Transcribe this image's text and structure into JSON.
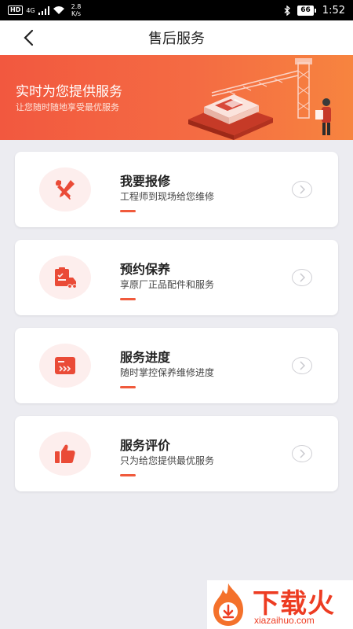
{
  "status_bar": {
    "hd": "HD",
    "signal_type": "4G",
    "speed_value": "2.8",
    "speed_unit": "K/s",
    "battery": "66",
    "time": "1:52"
  },
  "nav": {
    "title": "售后服务",
    "back_icon": "chevron-left-icon"
  },
  "banner": {
    "title": "实时为您提供服务",
    "subtitle": "让您随时随地享受最优服务"
  },
  "services": [
    {
      "title": "我要报修",
      "desc": "工程师到现场给您维修",
      "icon": "repair-tools-icon"
    },
    {
      "title": "预约保养",
      "desc": "享原厂正品配件和服务",
      "icon": "truck-checklist-icon"
    },
    {
      "title": "服务进度",
      "desc": "随时掌控保养维修进度",
      "icon": "progress-screen-icon"
    },
    {
      "title": "服务评价",
      "desc": "只为给您提供最优服务",
      "icon": "thumbs-up-icon"
    }
  ],
  "colors": {
    "accent": "#f05a3c",
    "icon_bg": "#fdeeed",
    "page_bg": "#ececf1"
  },
  "watermark": {
    "text": "下载火",
    "url": "xiazaihuo.com"
  }
}
